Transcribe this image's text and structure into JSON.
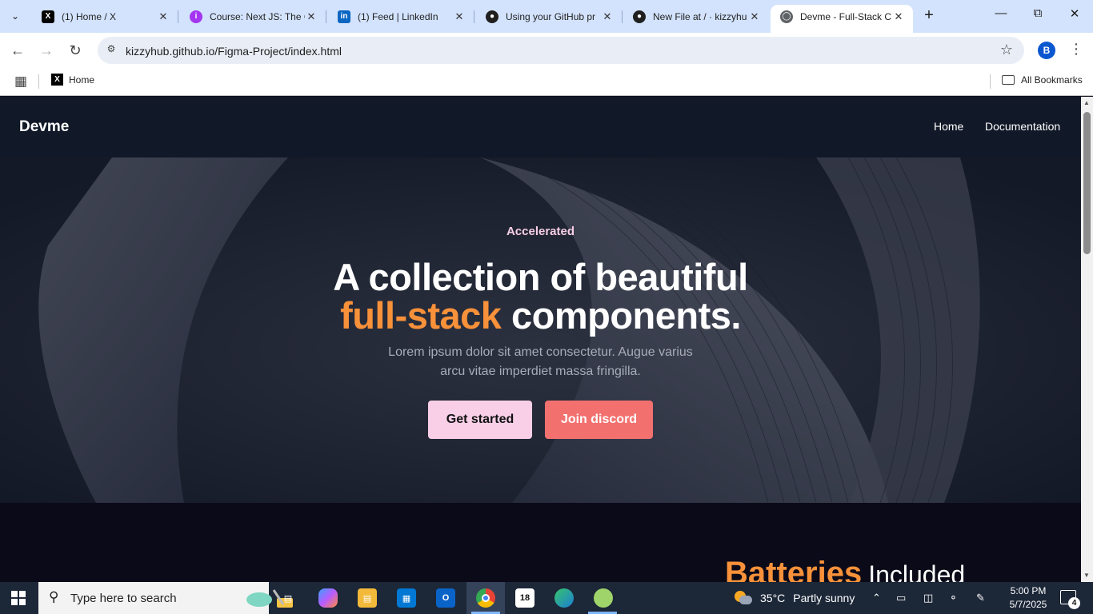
{
  "browser": {
    "tabs": [
      {
        "title": "(1) Home / X",
        "icon": "x-logo-icon",
        "active": false
      },
      {
        "title": "Course: Next JS: The C",
        "icon": "course-site-icon",
        "active": false
      },
      {
        "title": "(1) Feed | LinkedIn",
        "icon": "linkedin-icon",
        "active": false
      },
      {
        "title": "Using your GitHub pr",
        "icon": "github-icon",
        "active": false
      },
      {
        "title": "New File at / · kizzyhu",
        "icon": "github-icon",
        "active": false
      },
      {
        "title": "Devme - Full-Stack C",
        "icon": "globe-icon",
        "active": true
      }
    ],
    "url": "kizzyhub.github.io/Figma-Project/index.html",
    "profile_initial": "B",
    "bookmarks": [
      {
        "label": "Home",
        "icon": "x-logo-icon"
      }
    ],
    "all_bookmarks_label": "All Bookmarks"
  },
  "site": {
    "logo": "Devme",
    "nav": [
      "Home",
      "Documentation"
    ],
    "hero": {
      "kicker": "Accelerated",
      "title_line1": "A collection of beautiful",
      "title_highlight": "full-stack",
      "title_rest": "components.",
      "lead_line1": "Lorem ipsum dolor sit amet consectetur. Augue varius",
      "lead_line2": "arcu vitae imperdiet massa fringilla.",
      "primary_button": "Get started",
      "secondary_button": "Join discord"
    },
    "section2": {
      "heading_big": "Batteries",
      "heading_small": "Included"
    }
  },
  "colors": {
    "accent_orange": "#f7913a",
    "pink_button": "#f9cfe7",
    "coral_button": "#f2716f",
    "nav_bg": "#111827"
  },
  "taskbar": {
    "search_placeholder": "Type here to search",
    "weather_temp": "35°C",
    "weather_text": "Partly sunny",
    "time": "5:00 PM",
    "date": "5/7/2025",
    "notification_count": "4",
    "pinned_badge": "18"
  }
}
